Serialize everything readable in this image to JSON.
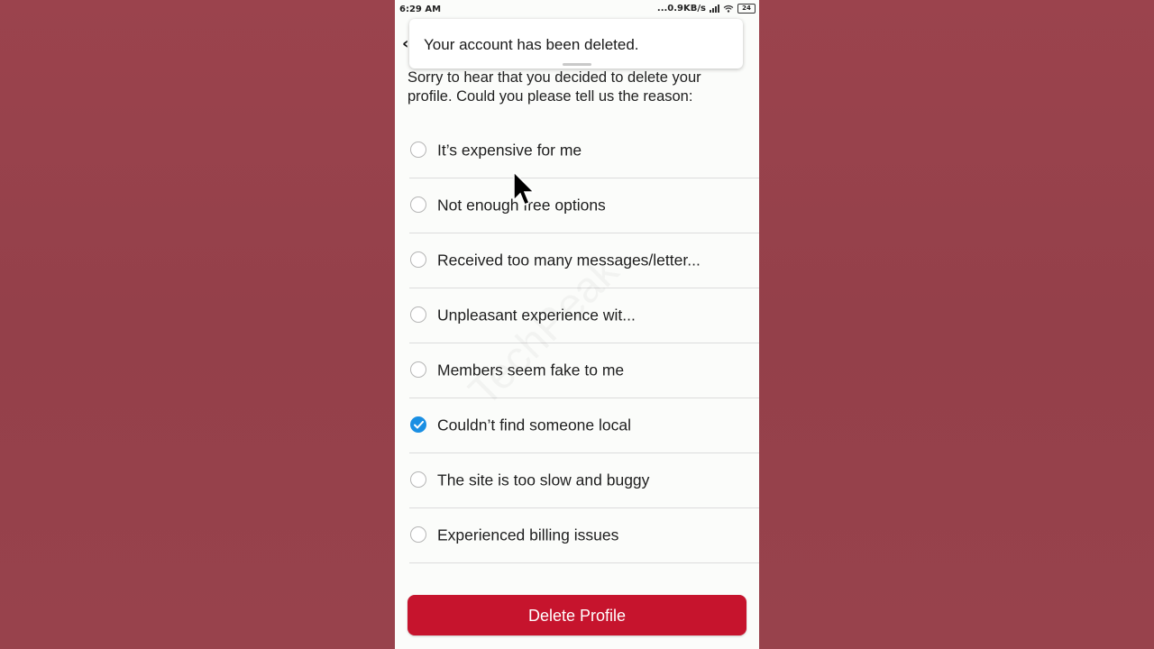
{
  "status_bar": {
    "time": "6:29 AM",
    "network_speed": "0.9KB/s",
    "battery": "24",
    "icons": [
      "signal-icon",
      "wifi-icon",
      "battery-icon"
    ]
  },
  "toast": {
    "message": "Your account has been deleted."
  },
  "intro_text": "Sorry to hear that you decided to delete your profile. Could you please tell us the reason:",
  "options": [
    {
      "label": "It’s expensive for me",
      "selected": false
    },
    {
      "label": "Not enough free options",
      "selected": false
    },
    {
      "label": "Received too many messages/letter...",
      "selected": false
    },
    {
      "label": "Unpleasant experience wit...",
      "selected": false
    },
    {
      "label": "Members seem fake to me",
      "selected": false
    },
    {
      "label": "Couldn’t find someone local",
      "selected": true
    },
    {
      "label": "The site is too slow and buggy",
      "selected": false
    },
    {
      "label": "Experienced billing issues",
      "selected": false
    }
  ],
  "delete_button": "Delete Profile",
  "colors": {
    "accent_red": "#c6142d",
    "radio_checked": "#1a8fe3",
    "side_background": "#96404a"
  }
}
